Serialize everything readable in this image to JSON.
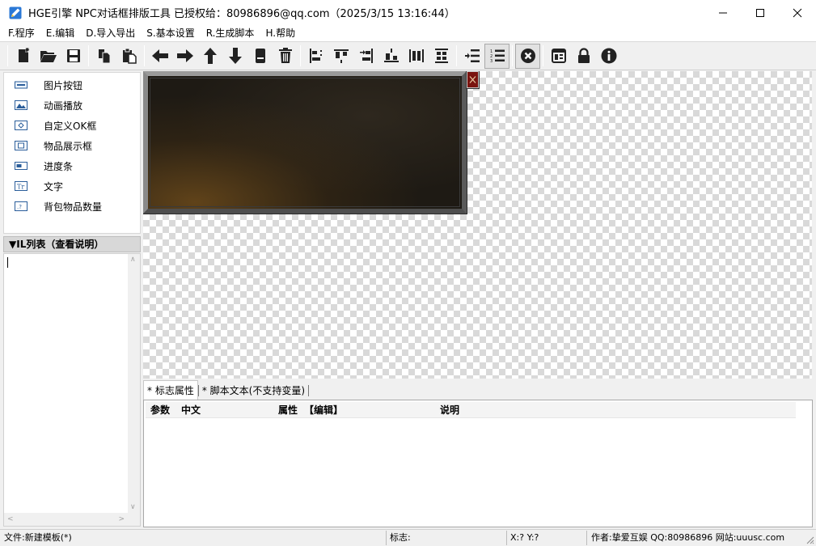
{
  "window": {
    "title": "HGE引擎 NPC对话框排版工具   已授权给：80986896@qq.com（2025/3/15 13:16:44）",
    "minimize": "—",
    "maximize": "☐",
    "close": "✕"
  },
  "menu": [
    "F.程序",
    "E.编辑",
    "D.导入导出",
    "S.基本设置",
    "R.生成脚本",
    "H.帮助"
  ],
  "toolbar": {
    "groups": [
      [
        "new-file-icon",
        "open-folder-icon",
        "save-icon"
      ],
      [
        "copy-icon",
        "paste-icon"
      ],
      [
        "arrow-left-icon",
        "arrow-right-icon",
        "arrow-up-icon",
        "arrow-down-icon",
        "clear-icon",
        "trash-icon"
      ],
      [
        "align-left-icon",
        "align-top-icon",
        "align-right-icon",
        "align-bottom-icon",
        "distribute-h-icon",
        "distribute-v-icon"
      ],
      [
        "indent-icon",
        "numbered-list-icon"
      ],
      [
        "close-circle-icon"
      ],
      [
        "layout-icon",
        "lock-icon",
        "info-icon"
      ]
    ]
  },
  "widgets": [
    {
      "icon": "image-button-icon",
      "label": "图片按钮"
    },
    {
      "icon": "animation-icon",
      "label": "动画播放"
    },
    {
      "icon": "custom-ok-box-icon",
      "label": "自定义OK框"
    },
    {
      "icon": "item-display-icon",
      "label": "物品展示框"
    },
    {
      "icon": "progress-bar-icon",
      "label": "进度条"
    },
    {
      "icon": "text-icon",
      "label": "文字"
    },
    {
      "icon": "bag-item-count-icon",
      "label": "背包物品数量"
    }
  ],
  "wil_list": {
    "header": "▼IL列表（查看说明）"
  },
  "bottom_tabs": [
    "* 标志属性",
    "* 脚本文本(不支持变量)"
  ],
  "grid_columns": [
    "参数",
    "中文",
    "属性",
    "【编辑】",
    "说明"
  ],
  "status": {
    "file": "文件:新建模板(*)",
    "flag": "标志:",
    "coords": "X:?  Y:?",
    "author": "作者:挚爱互娱 QQ:80986896 网站:uuusc.com"
  },
  "colors": {
    "canvas_check": "#d9d9d9",
    "dialog_bg": "#1e1a14",
    "dialog_close": "#7a1410"
  }
}
